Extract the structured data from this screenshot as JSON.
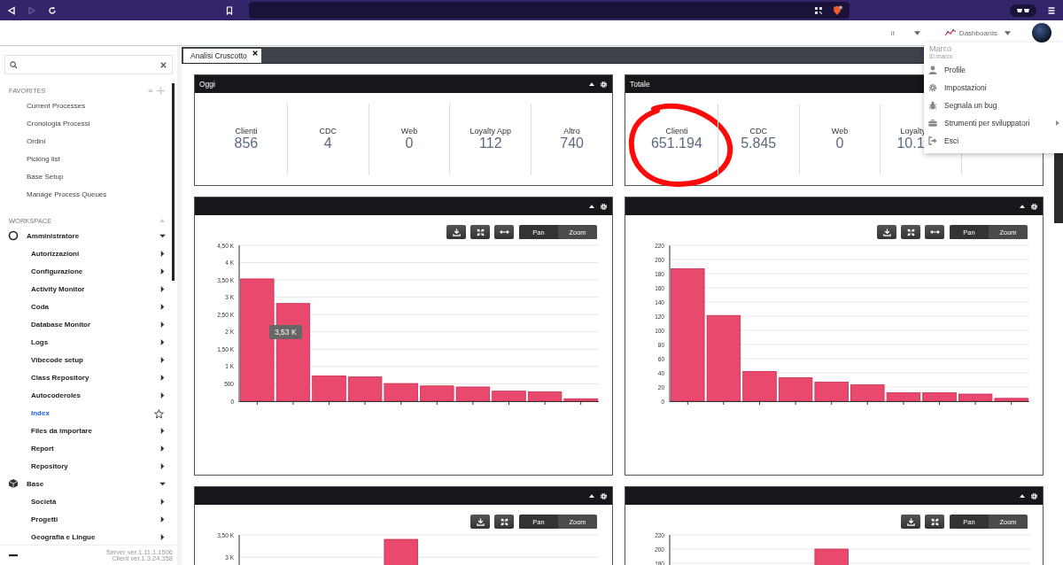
{
  "browser": {
    "forward_disabled": true
  },
  "header": {
    "language": "it",
    "dashboards": "Dashboards"
  },
  "user_menu": {
    "name": "Marco",
    "id": "ID:marco",
    "items": [
      {
        "label": "Profile",
        "kind": "user",
        "submenu": false
      },
      {
        "label": "Impostazioni",
        "kind": "gear",
        "submenu": false
      },
      {
        "label": "Segnala un bug",
        "kind": "bug",
        "submenu": false
      },
      {
        "label": "Strumenti per sviluppatori",
        "kind": "toolbox",
        "submenu": true
      },
      {
        "label": "Esci",
        "kind": "exit",
        "submenu": false
      }
    ]
  },
  "sidebar": {
    "favorites": {
      "title": "FAVORITES",
      "items": [
        "Current Processes",
        "Cronologia Processi",
        "Ordini",
        "Picking list",
        "Base Setup",
        "Manage Process Queues"
      ]
    },
    "workspace": {
      "title": "WORKSPACE",
      "items": [
        {
          "label": "Amministratore",
          "kind": "ring",
          "expanded": true,
          "children": [
            {
              "label": "Autorizzazioni",
              "submenu": true,
              "selected": false
            },
            {
              "label": "Configurazione",
              "submenu": true,
              "selected": false
            },
            {
              "label": "Activity Monitor",
              "submenu": true,
              "selected": false
            },
            {
              "label": "Coda",
              "submenu": true,
              "selected": false
            },
            {
              "label": "Database Monitor",
              "submenu": true,
              "selected": false
            },
            {
              "label": "Logs",
              "submenu": true,
              "selected": false
            },
            {
              "label": "Vibecode setup",
              "submenu": true,
              "selected": false
            },
            {
              "label": "Class Repository",
              "submenu": true,
              "selected": false
            },
            {
              "label": "Autocoderoles",
              "submenu": true,
              "selected": false
            },
            {
              "label": "Index",
              "submenu": false,
              "selected": true
            },
            {
              "label": "Files da importare",
              "submenu": true,
              "selected": false
            },
            {
              "label": "Report",
              "submenu": true,
              "selected": false
            },
            {
              "label": "Repository",
              "submenu": true,
              "selected": false
            }
          ]
        },
        {
          "label": "Base",
          "kind": "cube",
          "expanded": true,
          "children": [
            {
              "label": "Società",
              "submenu": true,
              "selected": false
            },
            {
              "label": "Progetti",
              "submenu": true,
              "selected": false
            },
            {
              "label": "Geografia e Lingue",
              "submenu": true,
              "selected": false
            }
          ]
        }
      ]
    },
    "footer": [
      "Server ver.1.11.1.1506",
      "Client ver.1.3.24.358"
    ]
  },
  "tab": {
    "label": "Analisi Cruscotto"
  },
  "stat_panels": [
    {
      "title": "Oggi",
      "header_icons": true,
      "stats": [
        {
          "label": "Clienti",
          "value": "856",
          "circled": false,
          "covered": false
        },
        {
          "label": "CDC",
          "value": "4",
          "circled": false,
          "covered": false
        },
        {
          "label": "Web",
          "value": "0",
          "circled": false,
          "covered": false
        },
        {
          "label": "Loyalty App",
          "value": "112",
          "circled": false,
          "covered": false
        },
        {
          "label": "Altro",
          "value": "740",
          "circled": false,
          "covered": false
        }
      ]
    },
    {
      "title": "Totale",
      "header_icons": false,
      "stats": [
        {
          "label": "Clienti",
          "value": "651.194",
          "circled": true,
          "covered": false
        },
        {
          "label": "CDC",
          "value": "5.845",
          "circled": false,
          "covered": false
        },
        {
          "label": "Web",
          "value": "0",
          "circled": false,
          "covered": false
        },
        {
          "label": "Loyalty",
          "value": "10.1",
          "circled": false,
          "covered": true
        }
      ]
    }
  ],
  "chart_panels": [
    {
      "fit_button": true,
      "pan": "Pan",
      "zoom": "Zoom",
      "tooltip": "3,53 K",
      "chart_data": {
        "type": "bar",
        "grid": true,
        "ylim": [
          0,
          4500
        ],
        "yticks": [
          {
            "value": 0,
            "label": "0"
          },
          {
            "value": 500,
            "label": "500"
          },
          {
            "value": 1000,
            "label": "1 K"
          },
          {
            "value": 1500,
            "label": "1,50 K"
          },
          {
            "value": 2000,
            "label": "2 K"
          },
          {
            "value": 2500,
            "label": "2,50 K"
          },
          {
            "value": 3000,
            "label": "3 K"
          },
          {
            "value": 3500,
            "label": "3,50 K"
          },
          {
            "value": 4000,
            "label": "4 K"
          },
          {
            "value": 4500,
            "label": "4,50 K"
          }
        ],
        "values": [
          3530,
          2820,
          730,
          700,
          510,
          440,
          410,
          290,
          270,
          70
        ]
      }
    },
    {
      "fit_button": true,
      "pan": "Pan",
      "zoom": "Zoom",
      "chart_data": {
        "type": "bar",
        "grid": true,
        "ylim": [
          0,
          220
        ],
        "yticks": [
          0,
          20,
          40,
          60,
          80,
          100,
          120,
          140,
          160,
          180,
          200,
          220
        ],
        "values": [
          187,
          121,
          42,
          33,
          27,
          23,
          12,
          12,
          10,
          4
        ]
      }
    },
    {
      "fit_button": false,
      "pan": "Pan",
      "zoom": "Zoom",
      "chart_data": {
        "type": "bar",
        "grid": true,
        "ylim": [
          0,
          3500
        ],
        "yticks": [
          {
            "value": 3000,
            "label": "3 K"
          },
          {
            "value": 3500,
            "label": "3,50 K"
          }
        ],
        "values": [
          null,
          null,
          null,
          null,
          3400,
          null,
          null,
          null,
          null,
          null
        ]
      }
    },
    {
      "fit_button": false,
      "pan": "Pan",
      "zoom": "Zoom",
      "chart_data": {
        "type": "bar",
        "grid": true,
        "ylim": [
          0,
          220
        ],
        "yticks": [
          180,
          200,
          220
        ],
        "values": [
          null,
          null,
          null,
          null,
          200,
          null,
          null,
          null,
          null,
          null
        ]
      }
    }
  ]
}
